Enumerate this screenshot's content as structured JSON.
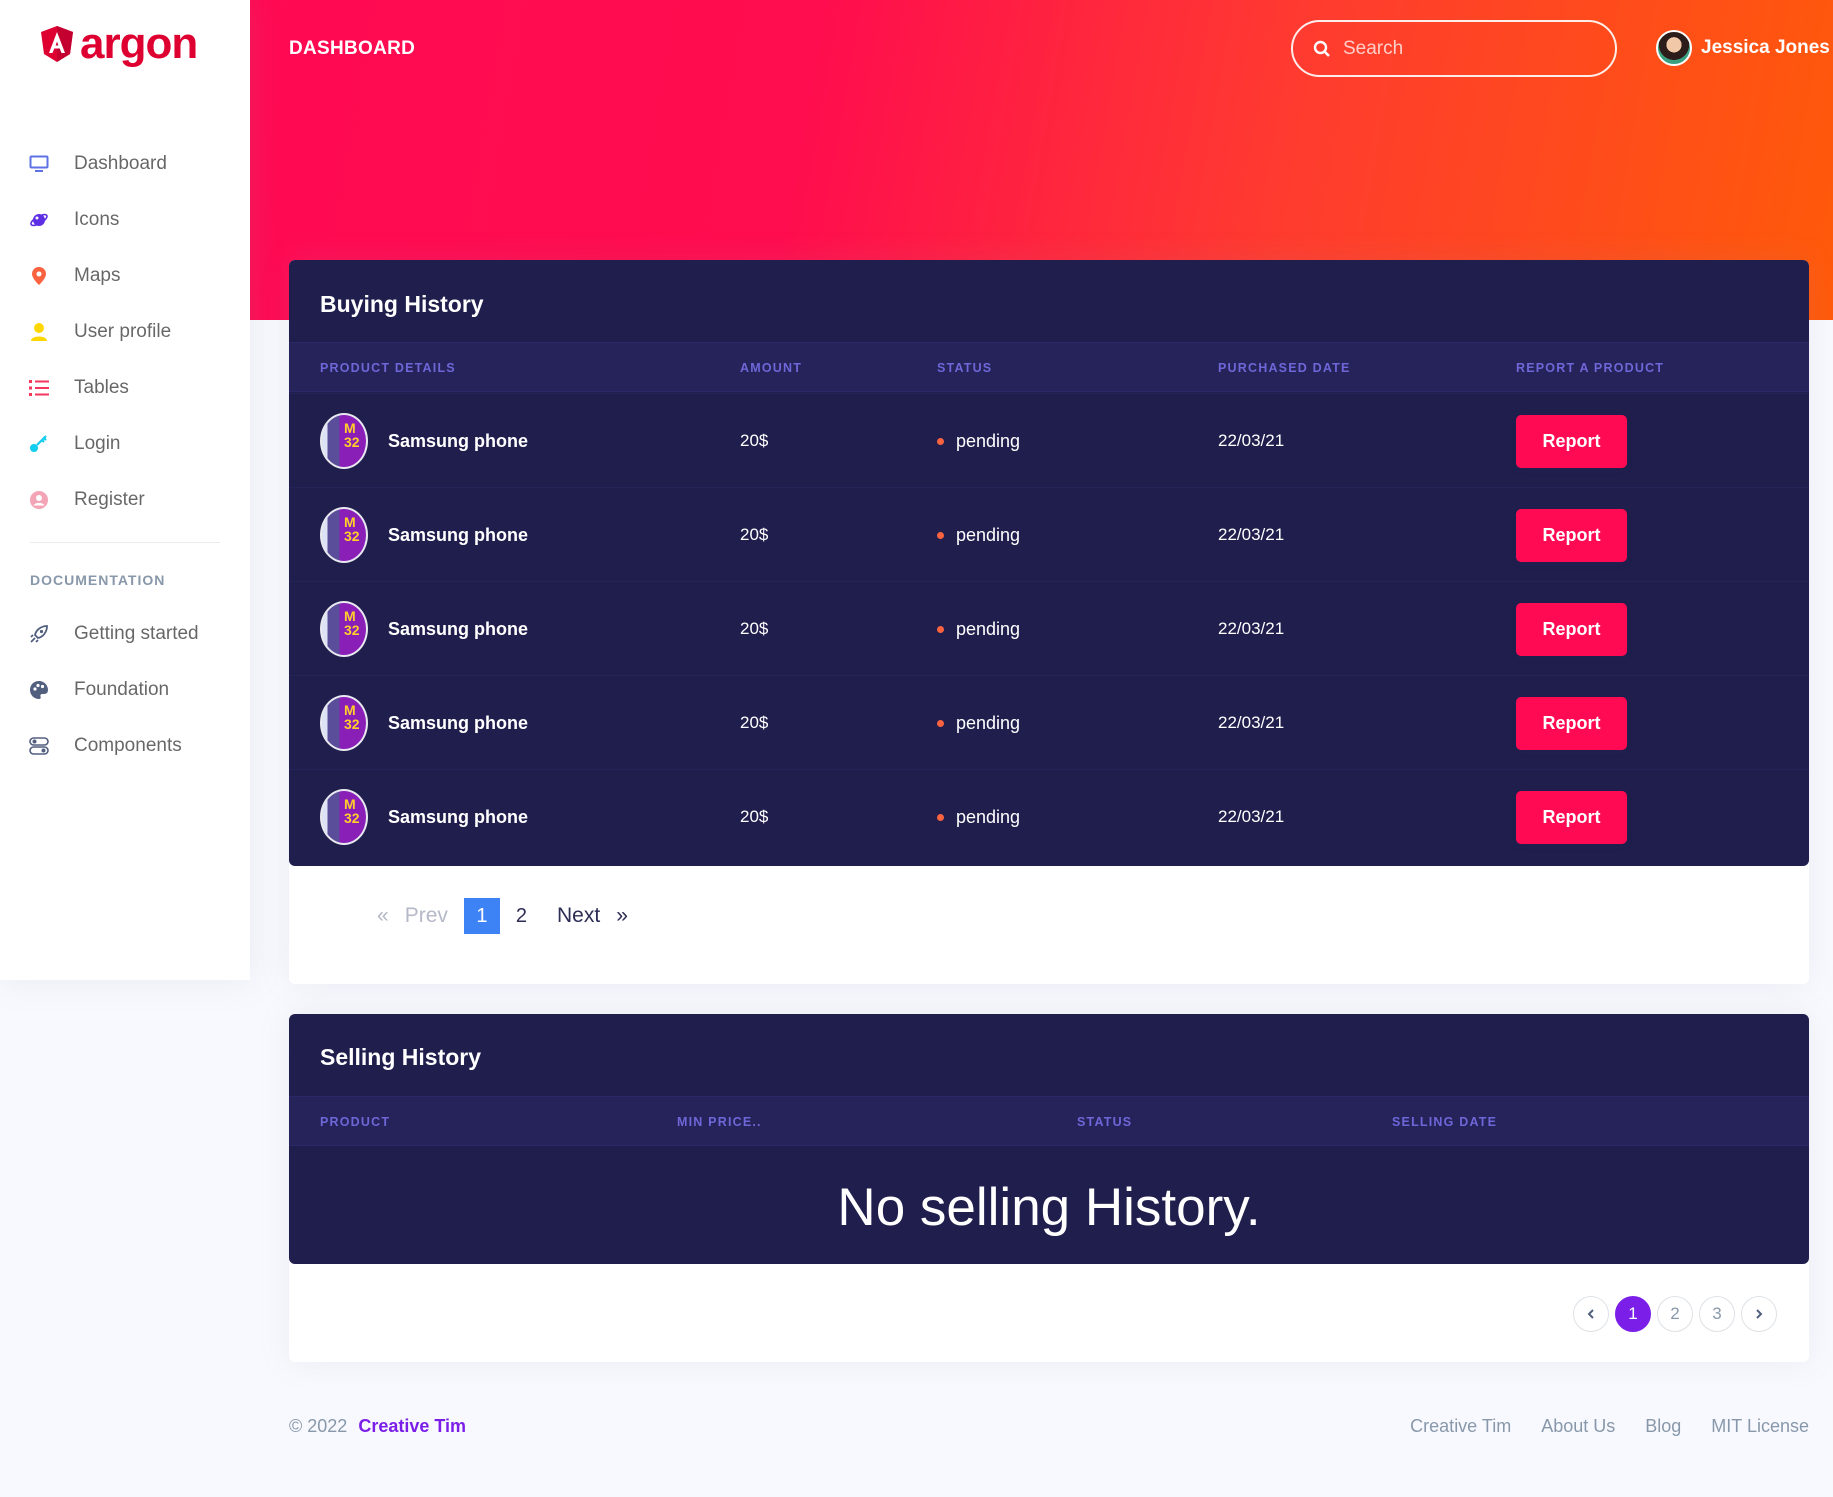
{
  "brand": {
    "name": "argon",
    "color": "#dd0031"
  },
  "sidebar": {
    "items": [
      {
        "label": "Dashboard",
        "icon": "tv-icon",
        "color": "#5e72e4"
      },
      {
        "label": "Icons",
        "icon": "planet-icon",
        "color": "#5e2ee4"
      },
      {
        "label": "Maps",
        "icon": "pin-icon",
        "color": "#fb6340"
      },
      {
        "label": "User profile",
        "icon": "user-icon",
        "color": "#ffd600"
      },
      {
        "label": "Tables",
        "icon": "list-icon",
        "color": "#f5365c"
      },
      {
        "label": "Login",
        "icon": "key-icon",
        "color": "#11cdef"
      },
      {
        "label": "Register",
        "icon": "circle-user-icon",
        "color": "#f3a4b5"
      }
    ],
    "docs_heading": "Documentation",
    "docs": [
      {
        "label": "Getting started",
        "icon": "spaceship-icon"
      },
      {
        "label": "Foundation",
        "icon": "palette-icon"
      },
      {
        "label": "Components",
        "icon": "ui-04-icon"
      }
    ]
  },
  "header": {
    "title": "DASHBOARD",
    "search_placeholder": "Search",
    "user_name": "Jessica Jones"
  },
  "buying": {
    "title": "Buying History",
    "columns": [
      "Product details",
      "Amount",
      "Status",
      "Purchased Date",
      "Report a product"
    ],
    "rows": [
      {
        "product": "Samsung phone",
        "amount": "20$",
        "status": "pending",
        "date": "22/03/21",
        "action": "Report"
      },
      {
        "product": "Samsung phone",
        "amount": "20$",
        "status": "pending",
        "date": "22/03/21",
        "action": "Report"
      },
      {
        "product": "Samsung phone",
        "amount": "20$",
        "status": "pending",
        "date": "22/03/21",
        "action": "Report"
      },
      {
        "product": "Samsung phone",
        "amount": "20$",
        "status": "pending",
        "date": "22/03/21",
        "action": "Report"
      },
      {
        "product": "Samsung phone",
        "amount": "20$",
        "status": "pending",
        "date": "22/03/21",
        "action": "Report"
      }
    ],
    "pagination": {
      "first": "«",
      "prev": "Prev",
      "pages": [
        "1",
        "2"
      ],
      "current": "1",
      "next": "Next",
      "last": "»"
    }
  },
  "selling": {
    "title": "Selling History",
    "columns": [
      "Product",
      "Min price..",
      "Status",
      "Selling Date"
    ],
    "empty_message": "No selling History.",
    "pagination": {
      "prev": "‹",
      "pages": [
        "1",
        "2",
        "3"
      ],
      "current": "1",
      "next": "›"
    }
  },
  "footer": {
    "copyright": "© 2022",
    "brand_link": "Creative Tim",
    "links": [
      "Creative Tim",
      "About Us",
      "Blog",
      "MIT License"
    ]
  },
  "colors": {
    "accent_red": "#ff0a53",
    "card_dark": "#1f1e4d",
    "pager_active_blue": "#3d83f5",
    "pager_active_purple": "#7b1fe8"
  }
}
